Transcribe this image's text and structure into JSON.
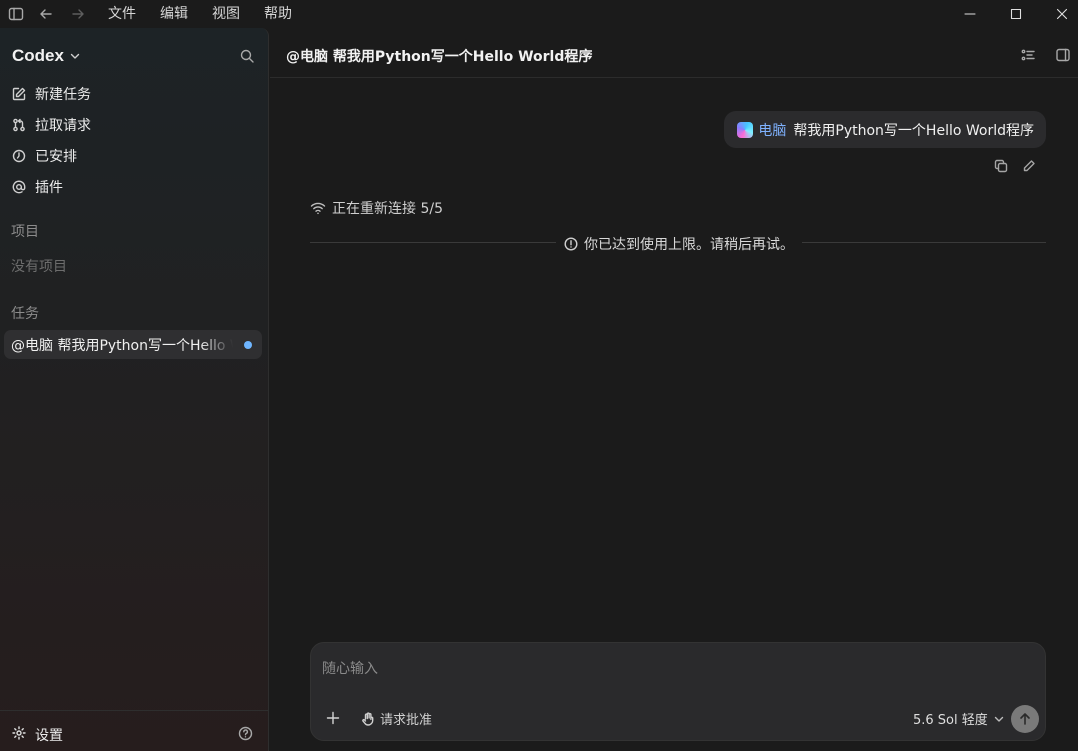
{
  "titlebar": {
    "menu": [
      "文件",
      "编辑",
      "视图",
      "帮助"
    ]
  },
  "sidebar": {
    "brand": "Codex",
    "nav": [
      {
        "label": "新建任务",
        "icon": "edit-icon"
      },
      {
        "label": "拉取请求",
        "icon": "pull-request-icon"
      },
      {
        "label": "已安排",
        "icon": "clock-icon"
      },
      {
        "label": "插件",
        "icon": "at-icon"
      }
    ],
    "projects_heading": "项目",
    "no_projects": "没有项目",
    "tasks_heading": "任务",
    "tasks": [
      {
        "label": "@电脑 帮我用Python写一个Hello World程序",
        "unread": true
      }
    ],
    "settings_label": "设置"
  },
  "main": {
    "title": "@电脑 帮我用Python写一个Hello World程序",
    "user_message": {
      "mention": "电脑",
      "text": "帮我用Python写一个Hello World程序"
    },
    "reconnect_status": "正在重新连接 5/5",
    "limit_notice": "你已达到使用上限。请稍后再试。",
    "composer": {
      "placeholder": "随心输入",
      "approval_label": "请求批准",
      "model_label": "5.6 Sol 轻度"
    }
  },
  "colors": {
    "accent_mention": "#7fb2ff",
    "unread_dot": "#6fb6ff",
    "bubble_bg": "#2b2b2d",
    "main_bg": "#1b1b1b"
  }
}
